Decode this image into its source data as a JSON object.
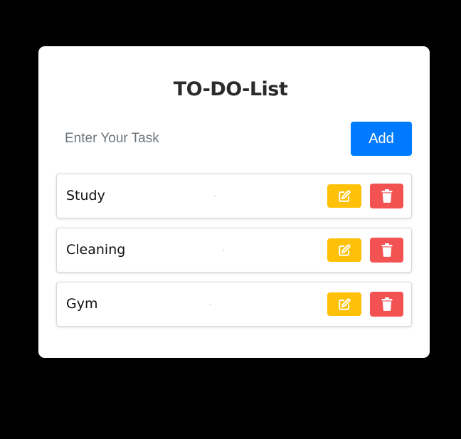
{
  "app": {
    "title": "TO-DO-List"
  },
  "input": {
    "placeholder": "Enter Your Task",
    "value": ""
  },
  "add_button": {
    "label": "Add"
  },
  "tasks": [
    {
      "label": "Study"
    },
    {
      "label": "Cleaning"
    },
    {
      "label": "Gym"
    }
  ],
  "icons": {
    "edit": "edit-icon",
    "delete": "trash-icon"
  },
  "colors": {
    "background": "#000000",
    "card": "#ffffff",
    "add_button": "#007bff",
    "edit_button": "#ffc107",
    "delete_button": "#f25252"
  }
}
